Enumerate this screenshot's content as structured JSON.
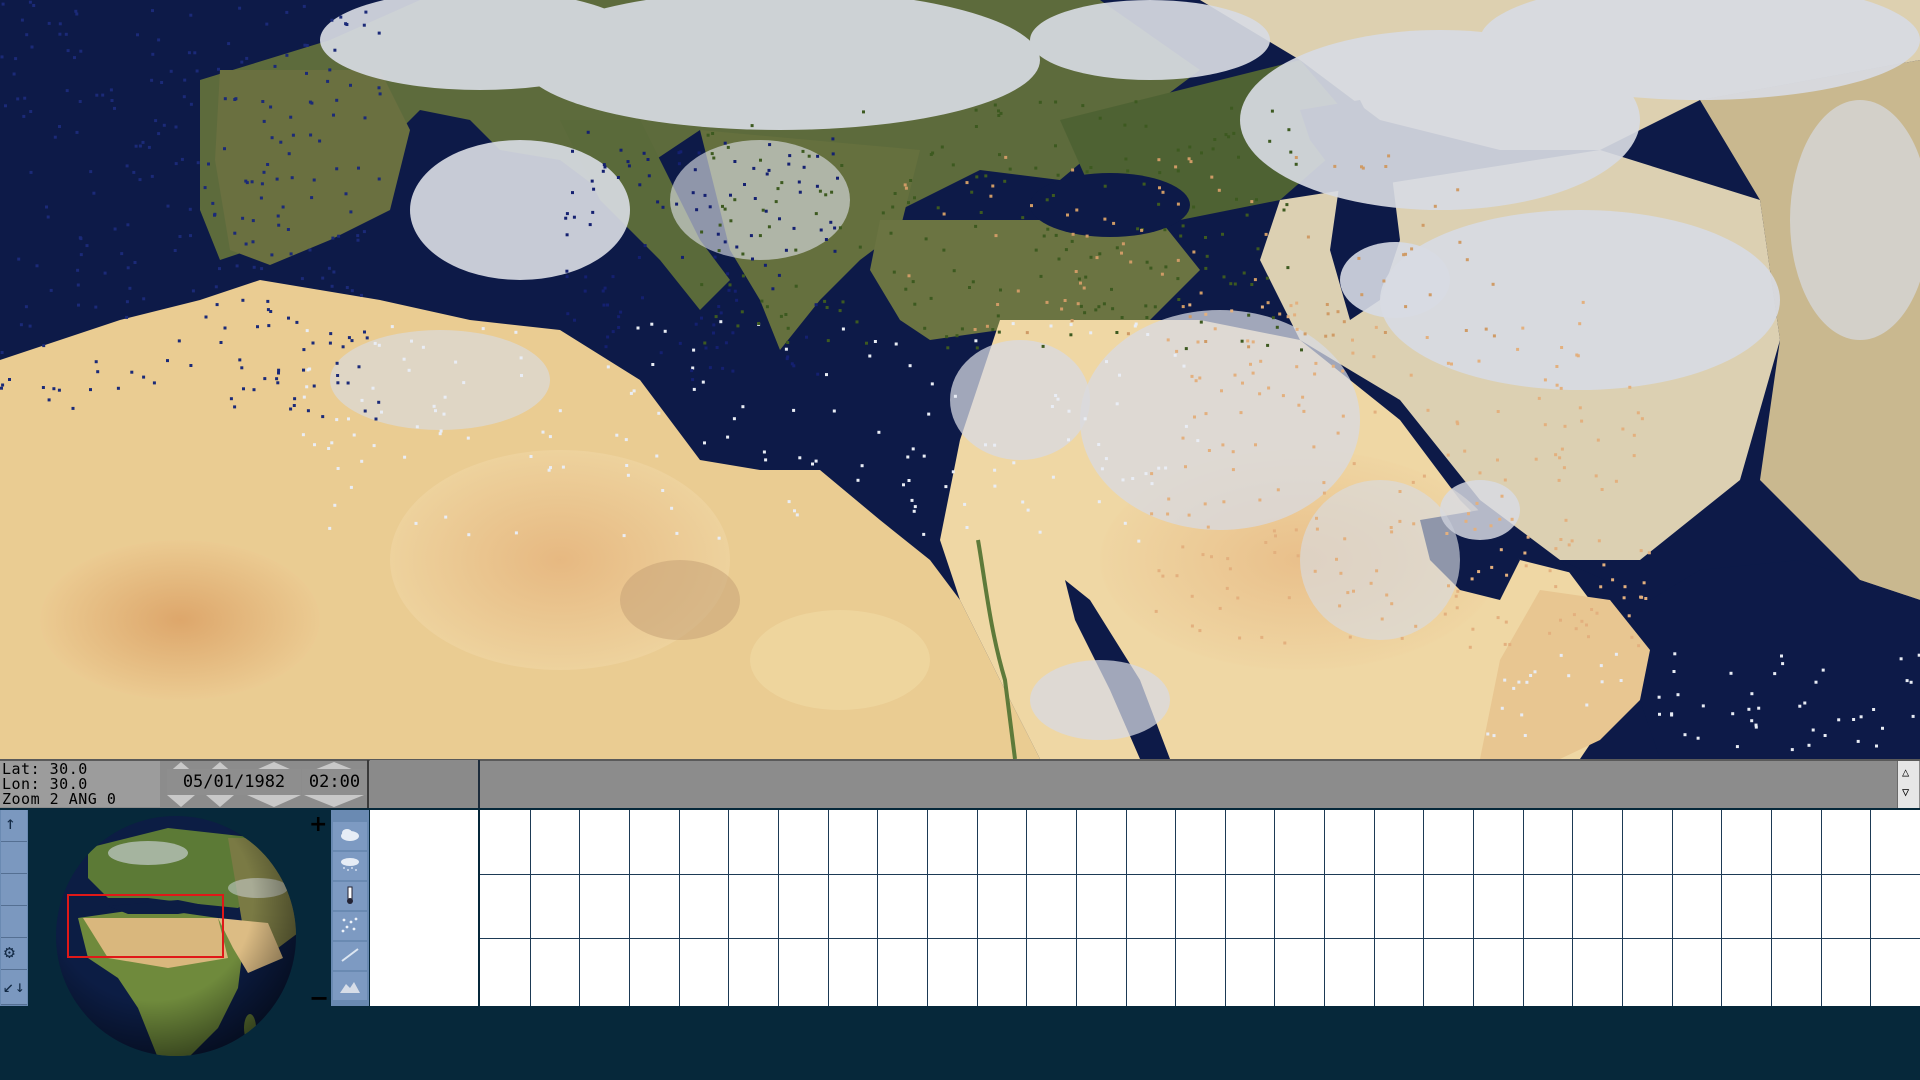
{
  "map": {
    "region": "Mediterranean, Middle East and North Africa",
    "layer": "rainfall/weather observation dots"
  },
  "readout": {
    "lat_label": "Lat:",
    "lat_value": "30.0",
    "lon_label": "Lon:",
    "lon_value": "30.0",
    "zoom_label": "Zoom",
    "zoom_value": "2",
    "angle_label": "ANG",
    "angle_value": "0"
  },
  "datetime": {
    "date": "05/01/1982",
    "time": "02:00"
  },
  "globe": {
    "zoom_in": "+",
    "zoom_out": "−"
  },
  "toolbar_icons": [
    "arrow-up-icon",
    "gear-icon",
    "arrow-down-left-icon",
    "arrow-down-icon"
  ],
  "weather_icons": [
    "cloud-icon",
    "rain-icon",
    "thermometer-icon",
    "snow-icon",
    "wind-icon",
    "mountain-icon"
  ],
  "scrollbar": {
    "up": "△",
    "down": "▽"
  },
  "colors": {
    "sea": "#0d1a48",
    "desert": "#e9c890",
    "cloud": "#d8dbe3",
    "panel_blue": "#6a8ab2",
    "strip_gray": "#8c8c8c",
    "frame": "#06283a"
  }
}
